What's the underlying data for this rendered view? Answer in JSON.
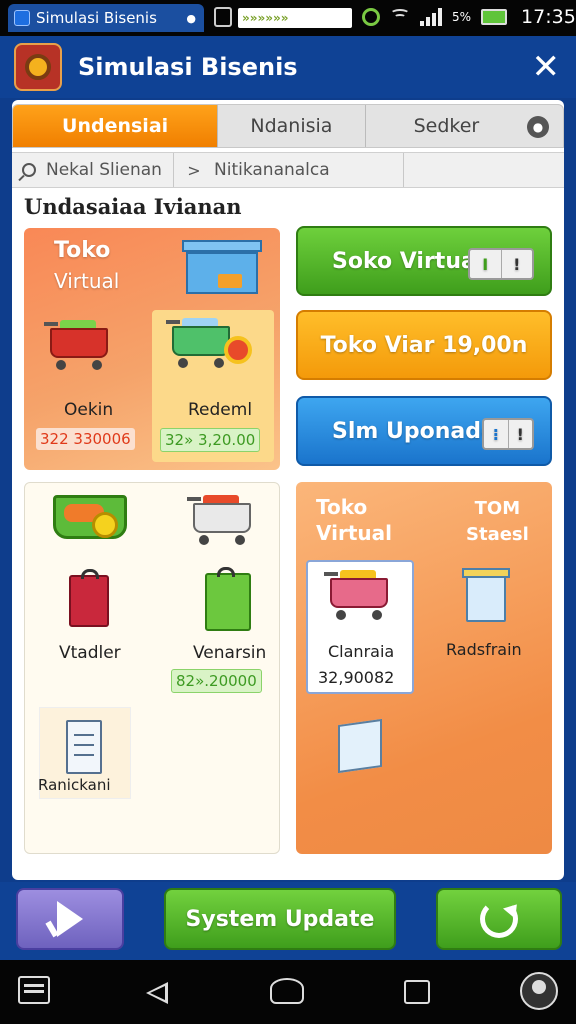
{
  "status_bar": {
    "app_tab": "Simulasi Bisenis",
    "notification_text": "»»»»»»",
    "battery_pct": "5%",
    "time": "17:35"
  },
  "header": {
    "title": "Simulasi Bisenis",
    "close_label": "✕"
  },
  "tabs": [
    {
      "label": "Undensiai",
      "active": true
    },
    {
      "label": "Ndanisia",
      "active": false
    },
    {
      "label": "Sedker",
      "active": false
    }
  ],
  "breadcrumb": {
    "search_placeholder": "Nekal Slienan",
    "separator": ">",
    "current": "Nitikananalca"
  },
  "section_title": "Undasaiaa Ivianan",
  "panel_top_left": {
    "title": "Toko",
    "subtitle": "Virtual",
    "items": [
      {
        "label": "Oekin",
        "price": "322 330006"
      },
      {
        "label": "Redeml",
        "price": "32» 3,20.00"
      }
    ]
  },
  "actions": [
    {
      "label": "Soko Virtual"
    },
    {
      "label": "Toko Viar 19,00n"
    },
    {
      "label": "Slm Uponade"
    }
  ],
  "panel_bottom_left": {
    "items": [
      {
        "label": "Vtadler"
      },
      {
        "label": "Venarsin",
        "price": "82».20000"
      },
      {
        "label": "Ranickani"
      }
    ]
  },
  "panel_bottom_right": {
    "title_left": "Toko",
    "subtitle_left": "Virtual",
    "title_right": "TOM",
    "subtitle_right": "Staesl",
    "items": [
      {
        "label": "Clanraia",
        "price": "32,90082"
      },
      {
        "label": "Radsfrain"
      }
    ]
  },
  "bottom_bar": {
    "system_update": "System Update"
  },
  "colors": {
    "primary": "#0f4295",
    "accent_orange": "#f49a0a",
    "accent_green": "#3f9e1c",
    "accent_blue": "#1a74cc"
  }
}
